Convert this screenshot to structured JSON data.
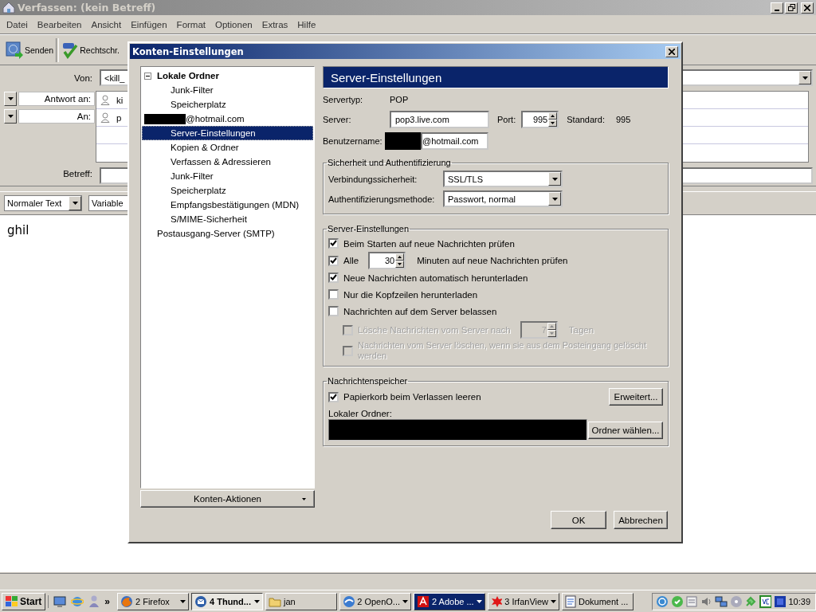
{
  "window": {
    "title": "Verfassen: (kein Betreff)"
  },
  "menu": [
    "Datei",
    "Bearbeiten",
    "Ansicht",
    "Einfügen",
    "Format",
    "Optionen",
    "Extras",
    "Hilfe"
  ],
  "toolbar": [
    {
      "label": "Senden",
      "kind": "send"
    },
    {
      "label": "Rechtschr.",
      "kind": "spell"
    }
  ],
  "compose": {
    "from_label": "Von:",
    "from_value": "<kill_",
    "recipients": [
      {
        "type": "Antwort an:",
        "value": "ki"
      },
      {
        "type": "An:",
        "value": "p"
      }
    ],
    "subject_label": "Betreff:"
  },
  "format_bar": {
    "paragraph_style": "Normaler Text",
    "font": "Variable"
  },
  "body": "ghil",
  "dialog": {
    "title": "Konten-Einstellungen",
    "tree": [
      {
        "label": "Lokale Ordner",
        "bold": true,
        "redacted": false,
        "expanded": true,
        "selected": false,
        "children": [
          {
            "label": "Junk-Filter",
            "selected": false
          },
          {
            "label": "Speicherplatz",
            "selected": false
          }
        ]
      },
      {
        "label": "@hotmail.com",
        "bold": false,
        "redacted": true,
        "expanded": true,
        "selected": false,
        "children": [
          {
            "label": "Server-Einstellungen",
            "selected": true
          },
          {
            "label": "Kopien & Ordner",
            "selected": false
          },
          {
            "label": "Verfassen & Adressieren",
            "selected": false
          },
          {
            "label": "Junk-Filter",
            "selected": false
          },
          {
            "label": "Speicherplatz",
            "selected": false
          },
          {
            "label": "Empfangsbestätigungen (MDN)",
            "selected": false
          },
          {
            "label": "S/MIME-Sicherheit",
            "selected": false
          }
        ]
      },
      {
        "label": "Postausgang-Server (SMTP)",
        "bold": false,
        "redacted": false,
        "selected": false
      }
    ],
    "account_actions": "Konten-Aktionen",
    "header": "Server-Einstellungen",
    "server_type": {
      "label": "Servertyp:",
      "value": "POP"
    },
    "server": {
      "label": "Server:",
      "value": "pop3.live.com"
    },
    "port": {
      "label": "Port:",
      "value": "995",
      "default_label": "Standard:",
      "default_value": "995"
    },
    "username": {
      "label": "Benutzername:",
      "value": "@hotmail.com",
      "redacted": true
    },
    "security": {
      "title": "Sicherheit und Authentifizierung",
      "rows": [
        {
          "label": "Verbindungssicherheit:",
          "value": "SSL/TLS"
        },
        {
          "label": "Authentifizierungsmethode:",
          "value": "Passwort, normal"
        }
      ]
    },
    "server_settings": {
      "title": "Server-Einstellungen",
      "options": [
        {
          "kind": "check",
          "label": "Beim Starten auf neue Nachrichten prüfen",
          "checked": true,
          "disabled": false
        },
        {
          "kind": "spin",
          "label": "Alle",
          "value": "30",
          "suffix": "Minuten auf neue Nachrichten prüfen",
          "checked": true,
          "disabled": false
        },
        {
          "kind": "check",
          "label": "Neue Nachrichten automatisch herunterladen",
          "checked": true,
          "disabled": false
        },
        {
          "kind": "check",
          "label": "Nur die Kopfzeilen herunterladen",
          "checked": false,
          "disabled": false
        },
        {
          "kind": "check",
          "label": "Nachrichten auf dem Server belassen",
          "checked": false,
          "disabled": false,
          "children": [
            {
              "kind": "spin",
              "label": "Lösche Nachrichten vom Server nach",
              "value": "7",
              "suffix": "Tagen",
              "checked": false,
              "disabled": true
            },
            {
              "kind": "check",
              "label": "Nachrichten vom Server löschen, wenn sie aus dem Posteingang gelöscht werden",
              "checked": false,
              "disabled": true
            }
          ]
        }
      ]
    },
    "storage": {
      "title": "Nachrichtenspeicher",
      "empty_trash": {
        "label": "Papierkorb beim Verlassen leeren",
        "checked": true
      },
      "advanced_button": "Erweitert...",
      "folder_label": "Lokaler Ordner:",
      "folder_redacted": true,
      "choose_button": "Ordner wählen..."
    },
    "buttons": [
      "OK",
      "Abbrechen"
    ]
  },
  "taskbar": {
    "start": "Start",
    "more": "»",
    "tasks": [
      {
        "label": "2 Firefox",
        "kind": "browser",
        "group": true,
        "selected": false,
        "flashing": false
      },
      {
        "label": "4 Thund...",
        "kind": "mail",
        "group": true,
        "selected": true,
        "flashing": false
      },
      {
        "label": "jan",
        "kind": "folder",
        "group": false,
        "selected": false,
        "flashing": false
      },
      {
        "label": "2 OpenO...",
        "kind": "office",
        "group": true,
        "selected": false,
        "flashing": false
      },
      {
        "label": "2 Adobe ...",
        "kind": "pdf",
        "group": true,
        "selected": false,
        "flashing": true
      },
      {
        "label": "3 IrfanView",
        "kind": "viewer",
        "group": true,
        "selected": false,
        "flashing": false
      },
      {
        "label": "Dokument ...",
        "kind": "document",
        "group": false,
        "selected": false,
        "flashing": false
      }
    ],
    "clock": "10:39"
  }
}
